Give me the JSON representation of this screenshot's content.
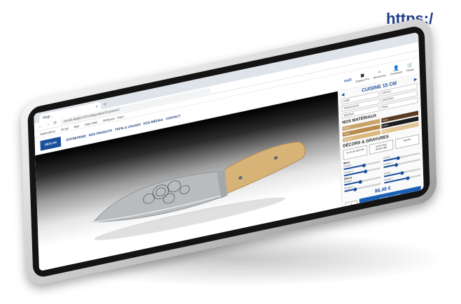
{
  "page": {
    "url_text": "https:/"
  },
  "browser": {
    "tab_title": "Régl...",
    "tab_close": "×",
    "new_tab": "+",
    "url": "mirrab.deglon.fr/Configurateur/Cuisine15",
    "bookmarks": [
      "Applications",
      "Gmail",
      "Mail",
      "Sites Web",
      "Réflexion - Rani..."
    ]
  },
  "site": {
    "logo": "DÉGLON",
    "nav": [
      "ENTREPRISE",
      "NOS PRODUITS",
      "TAPIS & USAGES",
      "NOS MÉDIAS",
      "CONTACT"
    ],
    "brand_small": "myD",
    "actions": [
      {
        "icon": "user-icon",
        "glyph": "◼",
        "label": "Espace Pro"
      },
      {
        "icon": "search-icon",
        "glyph": "⌕",
        "label": "Recherche"
      },
      {
        "icon": "user-icon",
        "glyph": "👤",
        "label": "Connexion"
      },
      {
        "icon": "cart-icon",
        "glyph": "🛒",
        "label": "Panier"
      }
    ]
  },
  "panel": {
    "prev_arrow": "◀",
    "next_arrow": "▶",
    "title": "CUISINE 15 CM",
    "options": [
      "CHEF",
      "OFFICE",
      "TRANCHEUR",
      "SANTOKU",
      "DÉSOSS.",
      "PAIN"
    ],
    "materials_title": "NOS MATÉRIAUX",
    "materials": [
      {
        "name": "Chêne",
        "color": "#c9a46a"
      },
      {
        "name": "Noyer",
        "color": "#5a3b22"
      },
      {
        "name": "Olivier",
        "color": "#b98a4e"
      },
      {
        "name": "Ébène",
        "color": "#1d1d1d"
      },
      {
        "name": "Bouleau",
        "color": "#d9b77d"
      },
      {
        "name": "Frêne",
        "color": "#e2c594"
      }
    ],
    "decor_title": "DÉCORS & GRAVURES",
    "decor_buttons": [
      "AUCUN DÉCOR",
      "AJOUTER GRAVURE",
      "MOTIF"
    ],
    "slider_groups": [
      {
        "title": "Bois",
        "sliders": [
          {
            "label": "Rotation",
            "value": 0.55
          },
          {
            "label": "Echelle",
            "value": 0.4
          },
          {
            "label": "Position X",
            "value": 0.6
          },
          {
            "label": "Position Y",
            "value": 0.35
          }
        ]
      },
      {
        "title": "Décor",
        "sliders": [
          {
            "label": "Rotation",
            "value": 0.45
          },
          {
            "label": "Echelle",
            "value": 0.5
          },
          {
            "label": "Position X",
            "value": 0.3
          },
          {
            "label": "Position Y",
            "value": 0.65
          }
        ]
      }
    ],
    "price": "96,48 €",
    "quantity": "1",
    "add_to_cart": "Ajouter au panier"
  }
}
